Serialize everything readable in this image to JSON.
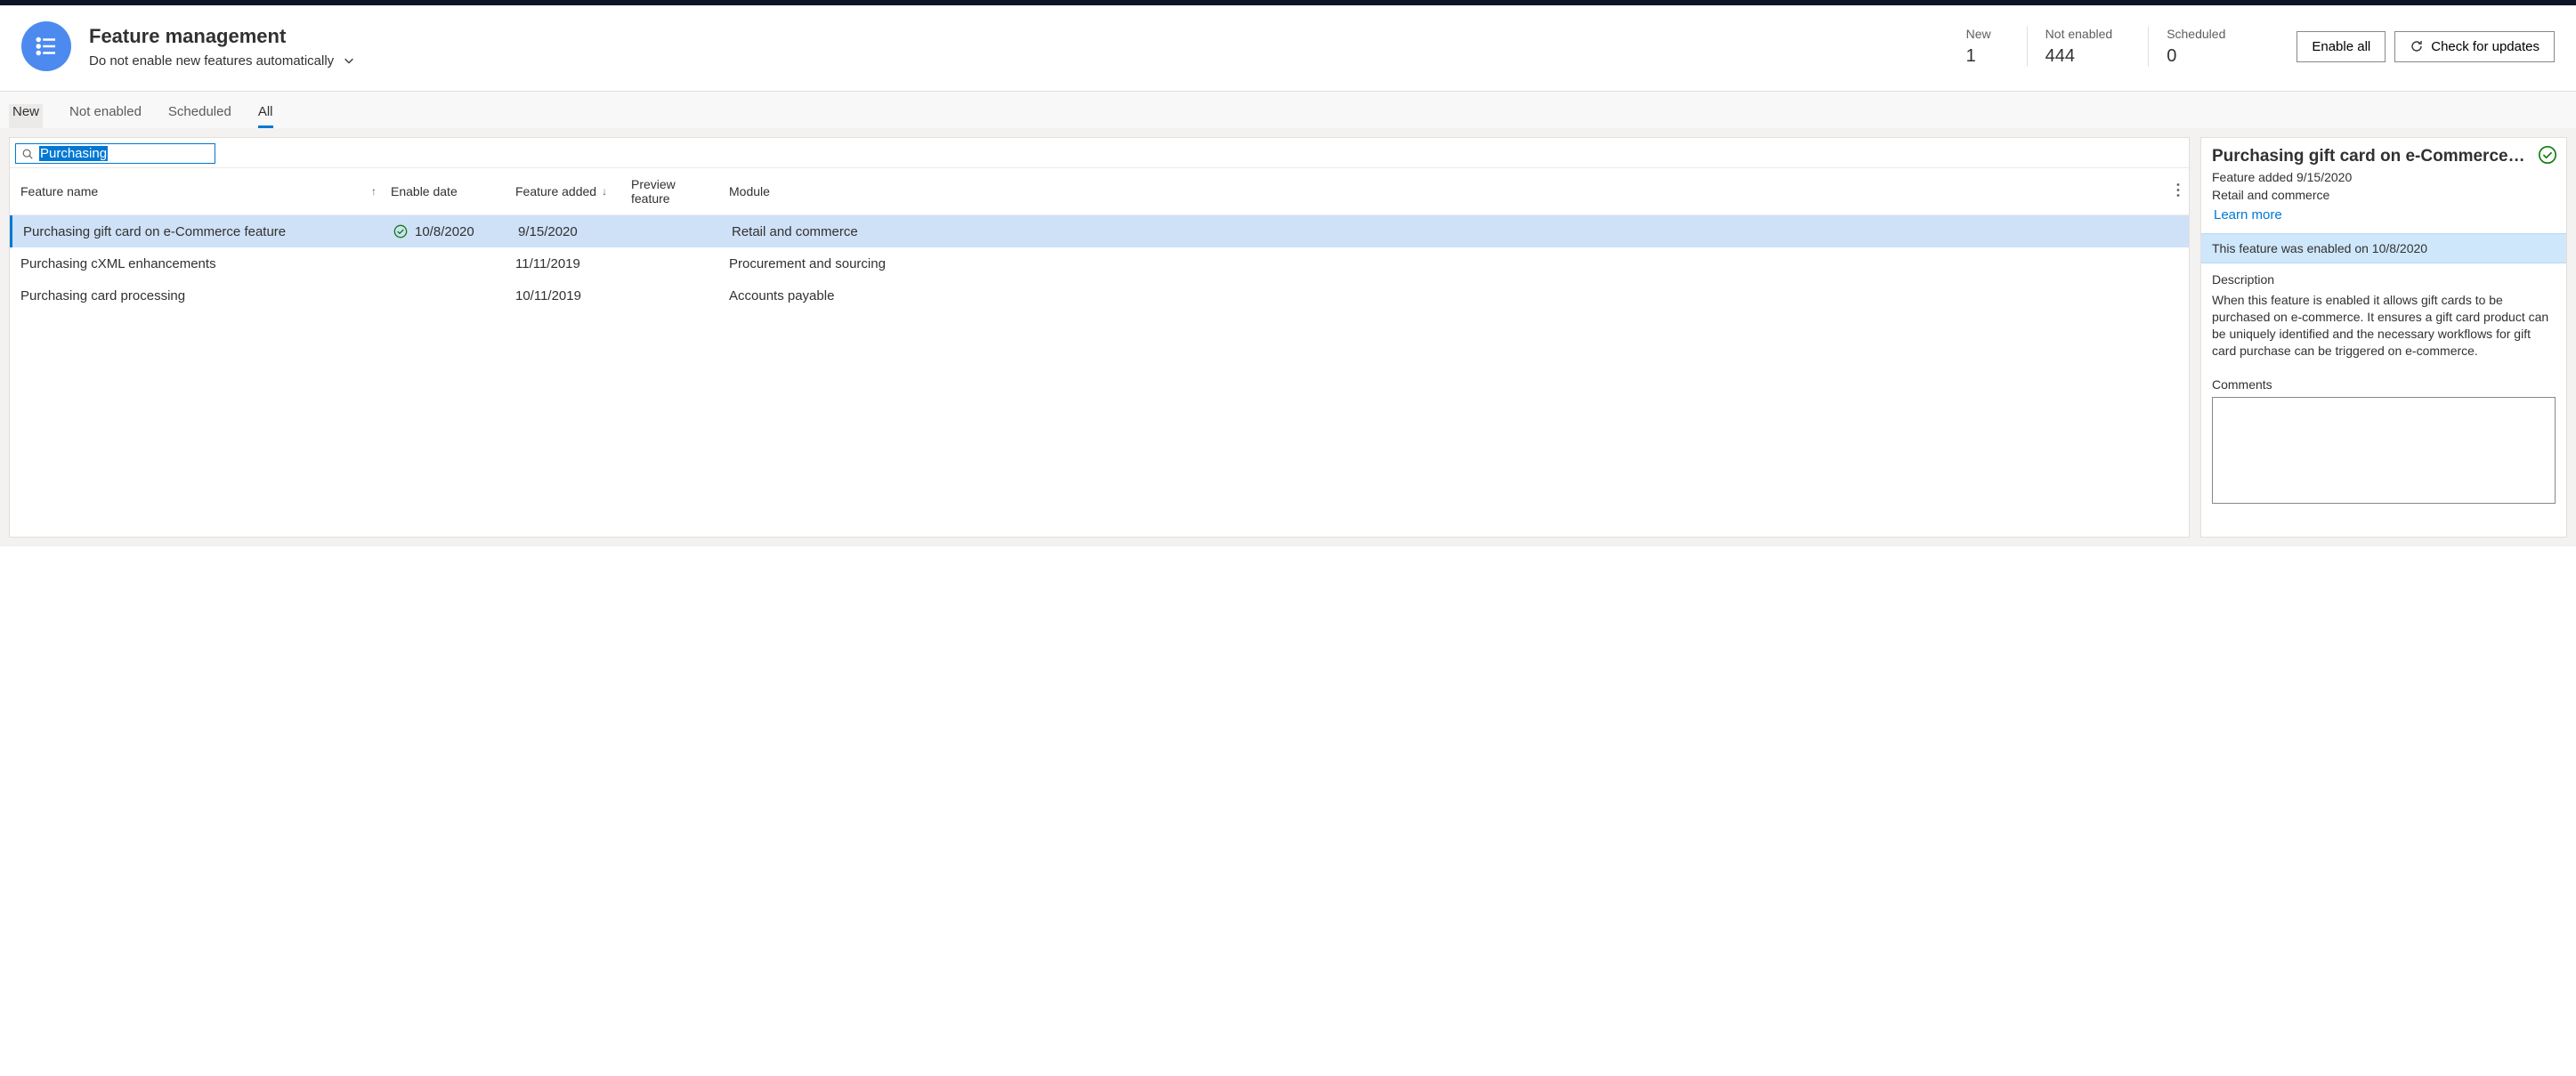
{
  "header": {
    "title": "Feature management",
    "subtitle": "Do not enable new features automatically",
    "stats": [
      {
        "label": "New",
        "value": "1"
      },
      {
        "label": "Not enabled",
        "value": "444"
      },
      {
        "label": "Scheduled",
        "value": "0"
      }
    ],
    "enable_all_label": "Enable all",
    "check_updates_label": "Check for updates"
  },
  "tabs": {
    "new": "New",
    "not_enabled": "Not enabled",
    "scheduled": "Scheduled",
    "all": "All"
  },
  "search": {
    "value": "Purchasing"
  },
  "columns": {
    "name": "Feature name",
    "enable_date": "Enable date",
    "feature_added": "Feature added",
    "preview": "Preview feature",
    "module": "Module"
  },
  "rows": [
    {
      "name": "Purchasing gift card on e-Commerce feature",
      "enabled": true,
      "enable_date": "10/8/2020",
      "added": "9/15/2020",
      "preview": "",
      "module": "Retail and commerce",
      "selected": true
    },
    {
      "name": "Purchasing cXML enhancements",
      "enabled": false,
      "enable_date": "",
      "added": "11/11/2019",
      "preview": "",
      "module": "Procurement and sourcing",
      "selected": false
    },
    {
      "name": "Purchasing card processing",
      "enabled": false,
      "enable_date": "",
      "added": "10/11/2019",
      "preview": "",
      "module": "Accounts payable",
      "selected": false
    }
  ],
  "detail": {
    "title": "Purchasing gift card on e-Commerce f…",
    "added_line": "Feature added 9/15/2020",
    "module_line": "Retail and commerce",
    "learn_more": "Learn more",
    "banner": "This feature was enabled on 10/8/2020",
    "description_label": "Description",
    "description_text": "When this feature is enabled it allows gift cards to be purchased on e-commerce. It ensures a gift card product can be uniquely identified and the necessary workflows for gift card purchase can be triggered on e-commerce.",
    "comments_label": "Comments",
    "comments_value": ""
  }
}
